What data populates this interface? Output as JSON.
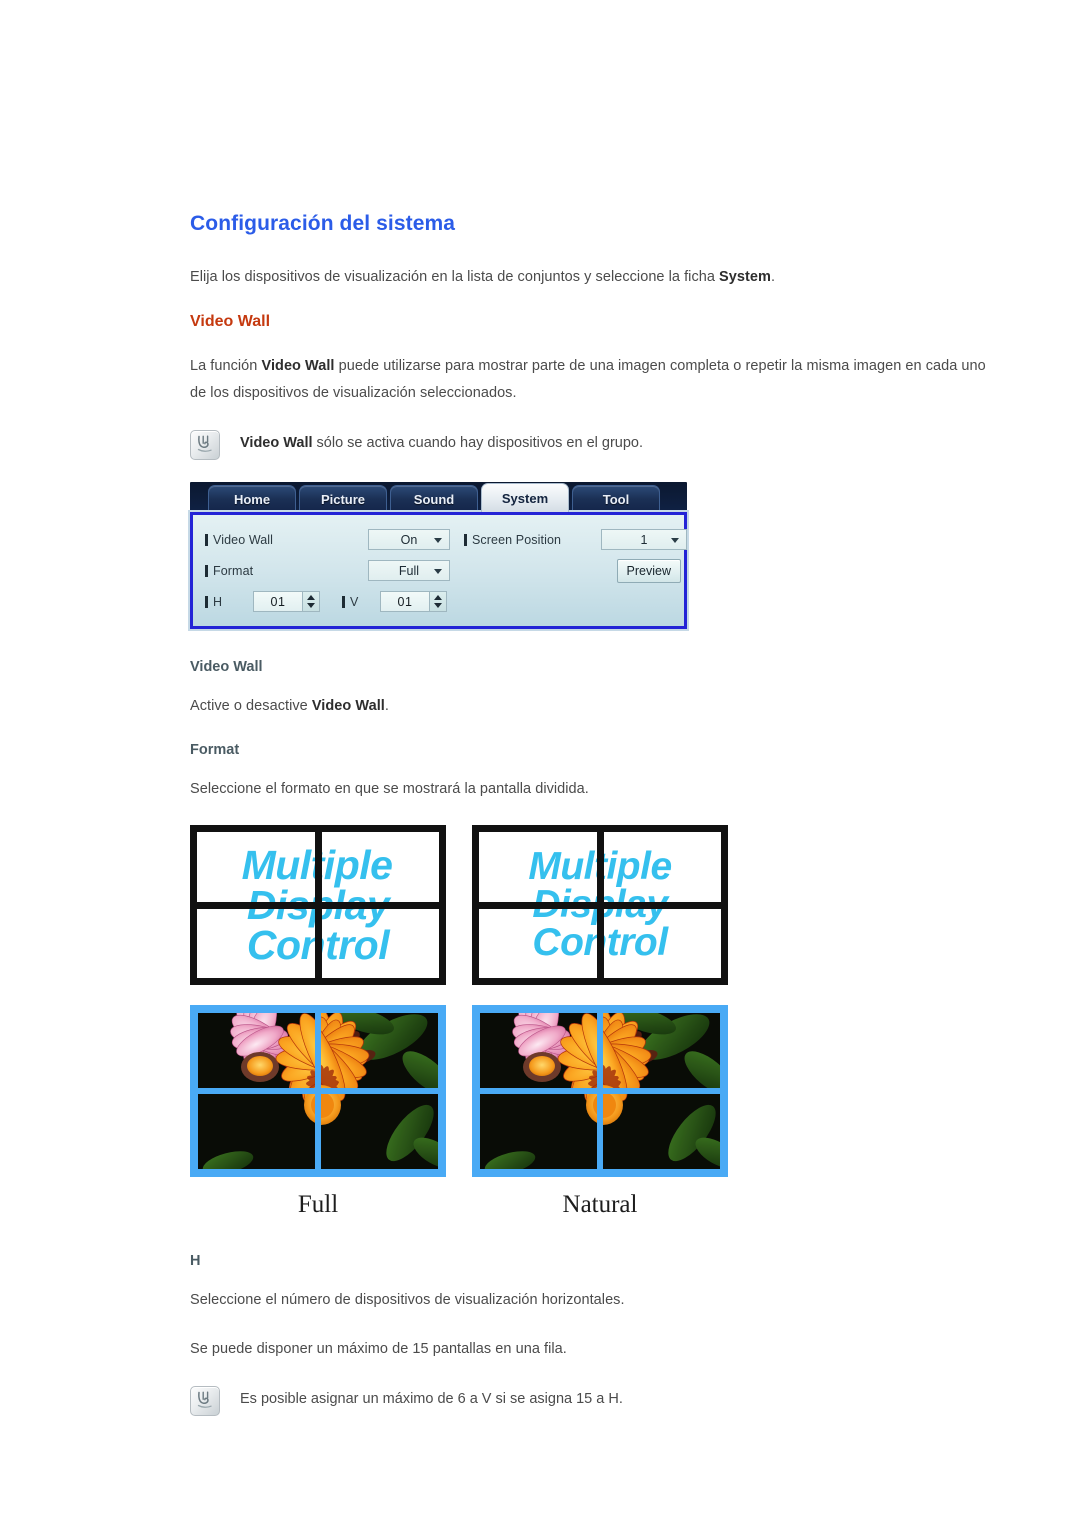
{
  "document": {
    "title": "Configuración del sistema",
    "intro_parts": [
      {
        "text": "Elija los dispositivos de visualización en la lista de conjuntos y seleccione la ficha ",
        "bold": false
      },
      {
        "text": "System",
        "bold": true
      },
      {
        "text": ".",
        "bold": false
      }
    ],
    "intro_plain": "Elija los dispositivos de visualización en la lista de conjuntos y seleccione la ficha System."
  },
  "video_wall_section": {
    "heading": "Video Wall",
    "description_pre": "La función ",
    "description_bold": "Video Wall",
    "description_post": " puede utilizarse para mostrar parte de una imagen completa o repetir la misma imagen en cada uno de los dispositivos de visualización seleccionados.",
    "note": {
      "icon": "note-pen-icon",
      "bold": "Video Wall",
      "text": " sólo se activa cuando hay dispositivos en el grupo."
    }
  },
  "mdc_panel": {
    "tabs": [
      {
        "label": "Home",
        "selected": false
      },
      {
        "label": "Picture",
        "selected": false
      },
      {
        "label": "Sound",
        "selected": false
      },
      {
        "label": "System",
        "selected": true
      },
      {
        "label": "Tool",
        "selected": false
      }
    ],
    "left_column": {
      "video_wall_label": "Video Wall",
      "video_wall_value": "On",
      "format_label": "Format",
      "format_value": "Full",
      "h_label": "H",
      "h_value": "01",
      "v_label": "V",
      "v_value": "01"
    },
    "right_column": {
      "screen_position_label": "Screen Position",
      "screen_position_value": "1",
      "preview_button": "Preview"
    },
    "colors": {
      "border": "#2323d6",
      "tabbar": "#0f2144",
      "panel_bg": "#d3e6ec"
    }
  },
  "subsections": [
    {
      "heading": "Video Wall",
      "body_pre": "Active o desactive ",
      "body_bold": "Video Wall",
      "body_post": "."
    },
    {
      "heading": "Format",
      "body_pre": "Seleccione el formato en que se mostrará la pantalla dividida.",
      "body_bold": "",
      "body_post": ""
    }
  ],
  "format_examples": {
    "wall_text_lines": [
      "Multiple",
      "Display",
      "Control"
    ],
    "wall_text_color": "#35c0ee",
    "photo_border_color": "#49aaf5",
    "captions": [
      "Full",
      "Natural"
    ]
  },
  "h_section": {
    "heading": "H",
    "line1": "Seleccione el número de dispositivos de visualización horizontales.",
    "line2": "Se puede disponer un máximo de 15 pantallas en una fila.",
    "note": {
      "icon": "note-pen-icon",
      "text": "Es posible asignar un máximo de 6 a V si se asigna 15 a H."
    }
  }
}
